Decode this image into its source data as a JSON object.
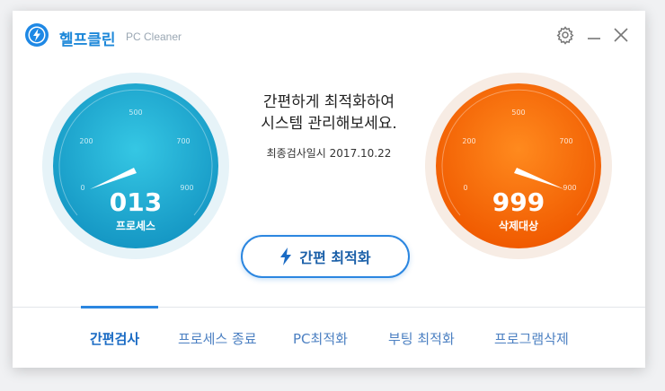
{
  "app": {
    "name": "헬프클린",
    "subtitle": "PC Cleaner"
  },
  "headline": {
    "line1": "간편하게 최적화하여",
    "line2": "시스템 관리해보세요."
  },
  "last_scan": "최종검사일시 2017.10.22",
  "gauges": {
    "left": {
      "value": "013",
      "label": "프로세스",
      "ticks": [
        "0",
        "200",
        "500",
        "700",
        "900"
      ]
    },
    "right": {
      "value": "999",
      "label": "삭제대상",
      "ticks": [
        "0",
        "200",
        "500",
        "700",
        "900"
      ]
    }
  },
  "quick_button": {
    "label": "간편 최적화"
  },
  "tabs": [
    {
      "label": "간편검사",
      "active": true
    },
    {
      "label": "프로세스 종료"
    },
    {
      "label": "PC최적화"
    },
    {
      "label": "부팅 최적화"
    },
    {
      "label": "프로그램삭제"
    }
  ],
  "colors": {
    "accent": "#2b86e0",
    "gauge_left": "#1fb1d3",
    "gauge_right": "#ff6a00"
  },
  "icons": {
    "settings": "gear-icon",
    "minimize": "minimize-icon",
    "close": "close-icon",
    "logo": "lightning-icon"
  }
}
